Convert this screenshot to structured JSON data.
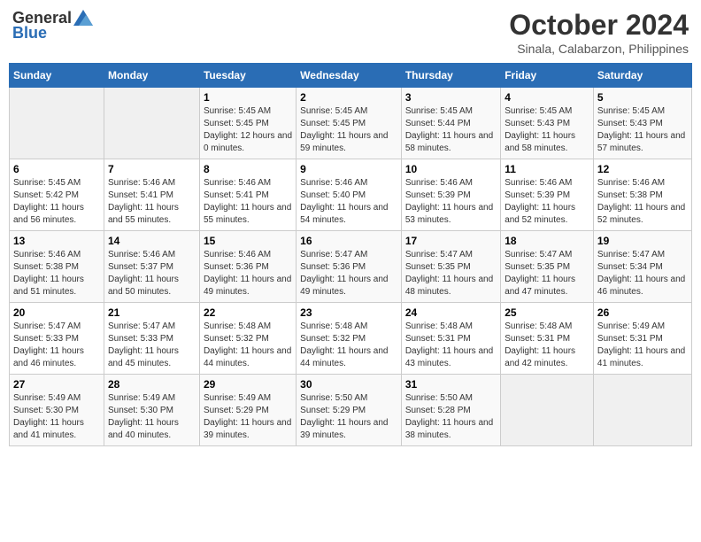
{
  "header": {
    "logo": {
      "general": "General",
      "blue": "Blue"
    },
    "title": "October 2024",
    "location": "Sinala, Calabarzon, Philippines"
  },
  "columns": [
    "Sunday",
    "Monday",
    "Tuesday",
    "Wednesday",
    "Thursday",
    "Friday",
    "Saturday"
  ],
  "weeks": [
    [
      {
        "day": "",
        "sunrise": "",
        "sunset": "",
        "daylight": ""
      },
      {
        "day": "",
        "sunrise": "",
        "sunset": "",
        "daylight": ""
      },
      {
        "day": "1",
        "sunrise": "Sunrise: 5:45 AM",
        "sunset": "Sunset: 5:45 PM",
        "daylight": "Daylight: 12 hours and 0 minutes."
      },
      {
        "day": "2",
        "sunrise": "Sunrise: 5:45 AM",
        "sunset": "Sunset: 5:45 PM",
        "daylight": "Daylight: 11 hours and 59 minutes."
      },
      {
        "day": "3",
        "sunrise": "Sunrise: 5:45 AM",
        "sunset": "Sunset: 5:44 PM",
        "daylight": "Daylight: 11 hours and 58 minutes."
      },
      {
        "day": "4",
        "sunrise": "Sunrise: 5:45 AM",
        "sunset": "Sunset: 5:43 PM",
        "daylight": "Daylight: 11 hours and 58 minutes."
      },
      {
        "day": "5",
        "sunrise": "Sunrise: 5:45 AM",
        "sunset": "Sunset: 5:43 PM",
        "daylight": "Daylight: 11 hours and 57 minutes."
      }
    ],
    [
      {
        "day": "6",
        "sunrise": "Sunrise: 5:45 AM",
        "sunset": "Sunset: 5:42 PM",
        "daylight": "Daylight: 11 hours and 56 minutes."
      },
      {
        "day": "7",
        "sunrise": "Sunrise: 5:46 AM",
        "sunset": "Sunset: 5:41 PM",
        "daylight": "Daylight: 11 hours and 55 minutes."
      },
      {
        "day": "8",
        "sunrise": "Sunrise: 5:46 AM",
        "sunset": "Sunset: 5:41 PM",
        "daylight": "Daylight: 11 hours and 55 minutes."
      },
      {
        "day": "9",
        "sunrise": "Sunrise: 5:46 AM",
        "sunset": "Sunset: 5:40 PM",
        "daylight": "Daylight: 11 hours and 54 minutes."
      },
      {
        "day": "10",
        "sunrise": "Sunrise: 5:46 AM",
        "sunset": "Sunset: 5:39 PM",
        "daylight": "Daylight: 11 hours and 53 minutes."
      },
      {
        "day": "11",
        "sunrise": "Sunrise: 5:46 AM",
        "sunset": "Sunset: 5:39 PM",
        "daylight": "Daylight: 11 hours and 52 minutes."
      },
      {
        "day": "12",
        "sunrise": "Sunrise: 5:46 AM",
        "sunset": "Sunset: 5:38 PM",
        "daylight": "Daylight: 11 hours and 52 minutes."
      }
    ],
    [
      {
        "day": "13",
        "sunrise": "Sunrise: 5:46 AM",
        "sunset": "Sunset: 5:38 PM",
        "daylight": "Daylight: 11 hours and 51 minutes."
      },
      {
        "day": "14",
        "sunrise": "Sunrise: 5:46 AM",
        "sunset": "Sunset: 5:37 PM",
        "daylight": "Daylight: 11 hours and 50 minutes."
      },
      {
        "day": "15",
        "sunrise": "Sunrise: 5:46 AM",
        "sunset": "Sunset: 5:36 PM",
        "daylight": "Daylight: 11 hours and 49 minutes."
      },
      {
        "day": "16",
        "sunrise": "Sunrise: 5:47 AM",
        "sunset": "Sunset: 5:36 PM",
        "daylight": "Daylight: 11 hours and 49 minutes."
      },
      {
        "day": "17",
        "sunrise": "Sunrise: 5:47 AM",
        "sunset": "Sunset: 5:35 PM",
        "daylight": "Daylight: 11 hours and 48 minutes."
      },
      {
        "day": "18",
        "sunrise": "Sunrise: 5:47 AM",
        "sunset": "Sunset: 5:35 PM",
        "daylight": "Daylight: 11 hours and 47 minutes."
      },
      {
        "day": "19",
        "sunrise": "Sunrise: 5:47 AM",
        "sunset": "Sunset: 5:34 PM",
        "daylight": "Daylight: 11 hours and 46 minutes."
      }
    ],
    [
      {
        "day": "20",
        "sunrise": "Sunrise: 5:47 AM",
        "sunset": "Sunset: 5:33 PM",
        "daylight": "Daylight: 11 hours and 46 minutes."
      },
      {
        "day": "21",
        "sunrise": "Sunrise: 5:47 AM",
        "sunset": "Sunset: 5:33 PM",
        "daylight": "Daylight: 11 hours and 45 minutes."
      },
      {
        "day": "22",
        "sunrise": "Sunrise: 5:48 AM",
        "sunset": "Sunset: 5:32 PM",
        "daylight": "Daylight: 11 hours and 44 minutes."
      },
      {
        "day": "23",
        "sunrise": "Sunrise: 5:48 AM",
        "sunset": "Sunset: 5:32 PM",
        "daylight": "Daylight: 11 hours and 44 minutes."
      },
      {
        "day": "24",
        "sunrise": "Sunrise: 5:48 AM",
        "sunset": "Sunset: 5:31 PM",
        "daylight": "Daylight: 11 hours and 43 minutes."
      },
      {
        "day": "25",
        "sunrise": "Sunrise: 5:48 AM",
        "sunset": "Sunset: 5:31 PM",
        "daylight": "Daylight: 11 hours and 42 minutes."
      },
      {
        "day": "26",
        "sunrise": "Sunrise: 5:49 AM",
        "sunset": "Sunset: 5:31 PM",
        "daylight": "Daylight: 11 hours and 41 minutes."
      }
    ],
    [
      {
        "day": "27",
        "sunrise": "Sunrise: 5:49 AM",
        "sunset": "Sunset: 5:30 PM",
        "daylight": "Daylight: 11 hours and 41 minutes."
      },
      {
        "day": "28",
        "sunrise": "Sunrise: 5:49 AM",
        "sunset": "Sunset: 5:30 PM",
        "daylight": "Daylight: 11 hours and 40 minutes."
      },
      {
        "day": "29",
        "sunrise": "Sunrise: 5:49 AM",
        "sunset": "Sunset: 5:29 PM",
        "daylight": "Daylight: 11 hours and 39 minutes."
      },
      {
        "day": "30",
        "sunrise": "Sunrise: 5:50 AM",
        "sunset": "Sunset: 5:29 PM",
        "daylight": "Daylight: 11 hours and 39 minutes."
      },
      {
        "day": "31",
        "sunrise": "Sunrise: 5:50 AM",
        "sunset": "Sunset: 5:28 PM",
        "daylight": "Daylight: 11 hours and 38 minutes."
      },
      {
        "day": "",
        "sunrise": "",
        "sunset": "",
        "daylight": ""
      },
      {
        "day": "",
        "sunrise": "",
        "sunset": "",
        "daylight": ""
      }
    ]
  ]
}
